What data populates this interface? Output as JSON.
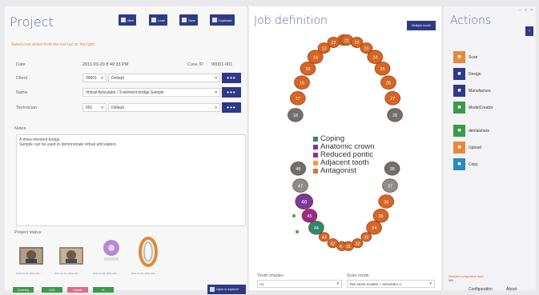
{
  "project": {
    "title": "Project",
    "toolbar": {
      "new_label": "New",
      "load_label": "Load",
      "save_label": "Save",
      "duplicate_label": "Duplicate"
    },
    "hint": "Select next action from the tool bar on the right.",
    "date_label": "Date",
    "date_value": "2011-03-20 8:49:33 PM",
    "caseid_label": "Case ID",
    "caseid_value": "00001-001",
    "client_label": "Client",
    "client_code": "00001",
    "client_value": "Default",
    "name_label": "Name",
    "name_value": "Virtual Articulator / 3-element bridge,Sample",
    "technician_label": "Technician",
    "technician_code": "001",
    "technician_value": "Default",
    "notes_label": "Notes",
    "notes_line1": "A three-element bridge.",
    "notes_line2": "Sample can be used to demonstrate virtual articulation.",
    "status_label": "Project status",
    "thumb_caption": "2011-03-20_0001-001-...",
    "status_pills": [
      {
        "label": "Scanning",
        "color": "#3b9a4b"
      },
      {
        "label": "CAD",
        "color": "#3b9a4b"
      },
      {
        "label": "Update",
        "color": "#e06b8a"
      },
      {
        "label": "In",
        "color": "#3b9a4b"
      }
    ],
    "open_explorer_label": "Open in explorer"
  },
  "job": {
    "title": "Job definition",
    "multiple_mode_label": "Multiple mode",
    "legend": [
      {
        "label": "Coping",
        "color": "#2e8a6e"
      },
      {
        "label": "Anatomic crown",
        "color": "#7b3a9a"
      },
      {
        "label": "Reduced pontic",
        "color": "#9a2a88"
      },
      {
        "label": "Adjacent tooth",
        "color": "#e8a23a"
      },
      {
        "label": "Antagonist",
        "color": "#e0702a"
      }
    ],
    "upper_teeth": [
      "11",
      "12",
      "13",
      "14",
      "15",
      "16",
      "17",
      "18",
      "21",
      "22",
      "23",
      "24",
      "25",
      "26",
      "27",
      "28"
    ],
    "lower_teeth": [
      "31",
      "32",
      "33",
      "34",
      "35",
      "36",
      "37",
      "38",
      "41",
      "42",
      "43",
      "44",
      "45",
      "46",
      "47",
      "48"
    ],
    "tooth_shades_label": "Tooth shades",
    "tooth_shades_value": "A1",
    "scan_mode_label": "Scan mode",
    "scan_mode_value": "Two stone models + articulator A"
  },
  "actions": {
    "title": "Actions",
    "items": [
      {
        "label": "Scan",
        "icon": "scan-icon",
        "color": "#e8893a"
      },
      {
        "label": "Design",
        "icon": "design-icon",
        "color": "#2e3a84"
      },
      {
        "label": "Manufacture",
        "icon": "manufacture-icon",
        "color": "#2e3a84"
      },
      {
        "label": "ModelCreator",
        "icon": "model-creator-icon",
        "color": "#3b9a4b"
      },
      {
        "label": "dentalshare",
        "icon": "dentalshare-icon",
        "color": "#3b9a4b"
      },
      {
        "label": "Upload",
        "icon": "upload-icon",
        "color": "#e8893a"
      },
      {
        "label": "Copy",
        "icon": "copy-icon",
        "color": "#2a8ab8"
      }
    ],
    "config_issue_title": "Detected configuration issue",
    "config_issue_text": "N/A",
    "configuration_label": "Configuration",
    "about_label": "About"
  },
  "window": {
    "minimize": "–",
    "maximize": "□",
    "close": "×"
  }
}
